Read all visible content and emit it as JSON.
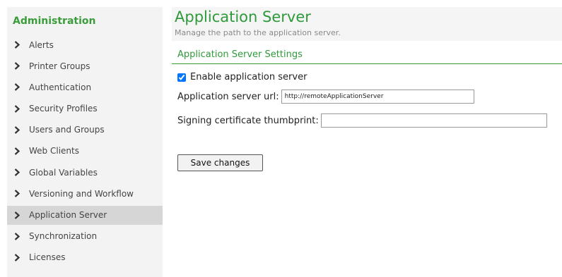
{
  "sidebar": {
    "title": "Administration",
    "items": [
      {
        "label": "Alerts",
        "icon": "chevron-right-icon",
        "active": false
      },
      {
        "label": "Printer Groups",
        "icon": "chevron-right-icon",
        "active": false
      },
      {
        "label": "Authentication",
        "icon": "chevron-right-icon",
        "active": false
      },
      {
        "label": "Security Profiles",
        "icon": "chevron-right-icon",
        "active": false
      },
      {
        "label": "Users and Groups",
        "icon": "chevron-right-icon",
        "active": false
      },
      {
        "label": "Web Clients",
        "icon": "chevron-right-icon",
        "active": false
      },
      {
        "label": "Global Variables",
        "icon": "chevron-right-icon",
        "active": false
      },
      {
        "label": "Versioning and Workflow",
        "icon": "chevron-right-icon",
        "active": false
      },
      {
        "label": "Application Server",
        "icon": "chevron-right-icon",
        "active": true
      },
      {
        "label": "Synchronization",
        "icon": "chevron-right-icon",
        "active": false
      },
      {
        "label": "Licenses",
        "icon": "chevron-right-icon",
        "active": false
      }
    ]
  },
  "page": {
    "title": "Application Server",
    "subtitle": "Manage the path to the application server."
  },
  "settings": {
    "section_title": "Application Server Settings",
    "enable_label": "Enable application server",
    "enable_checked": true,
    "url_label": "Application server url:",
    "url_value": "http://remoteApplicationServer",
    "thumbprint_label": "Signing certificate thumbprint:",
    "thumbprint_value": "",
    "save_label": "Save changes"
  },
  "colors": {
    "accent": "#2e9a3a",
    "sidebar_bg": "#f3f3f3",
    "active_item_bg": "#d6d6d6"
  }
}
